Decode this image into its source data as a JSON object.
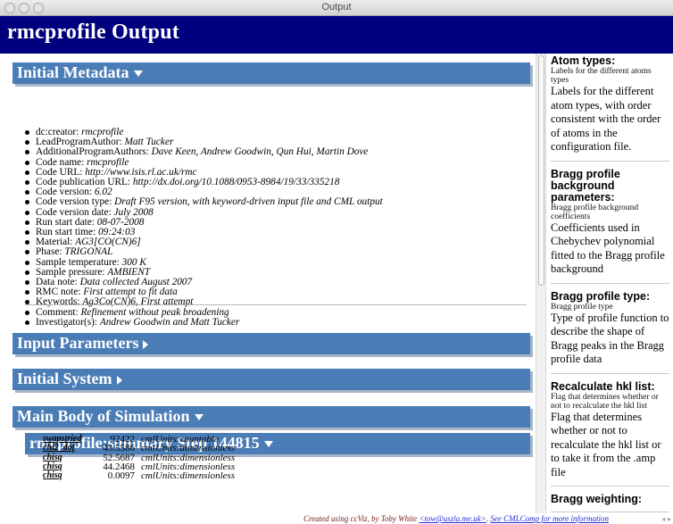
{
  "window": {
    "title": "Output"
  },
  "app": {
    "title": "rmcprofile Output"
  },
  "sections": {
    "initial_metadata": "Initial Metadata",
    "input_parameters": "Input Parameters",
    "initial_system": "Initial System",
    "main_body": "Main Body of Simulation",
    "summary_step": "rmcprofile:summary Step 144815"
  },
  "metadata": [
    {
      "key": "dc:creator: ",
      "value": "rmcprofile"
    },
    {
      "key": "LeadProgramAuthor: ",
      "value": "Matt Tucker"
    },
    {
      "key": "AdditionalProgramAuthors: ",
      "value": "Dave Keen, Andrew Goodwin, Qun Hui, Martin Dove"
    },
    {
      "key": "Code name: ",
      "value": "rmcprofile"
    },
    {
      "key": "Code URL: ",
      "value": "http://www.isis.rl.ac.uk/rmc"
    },
    {
      "key": "Code publication URL: ",
      "value": "http://dx.doi.org/10.1088/0953-8984/19/33/335218"
    },
    {
      "key": "Code version: ",
      "value": "6.02"
    },
    {
      "key": "Code version type: ",
      "value": "Draft F95 version, with keyword-driven input file and CML output"
    },
    {
      "key": "Code version date: ",
      "value": "July 2008"
    },
    {
      "key": "Run start date: ",
      "value": "08-07-2008"
    },
    {
      "key": "Run start time: ",
      "value": "09:24:03"
    },
    {
      "key": "Material: ",
      "value": "AG3[CO(CN)6]"
    },
    {
      "key": "Phase: ",
      "value": "TRIGONAL"
    },
    {
      "key": "Sample temperature: ",
      "value": "300 K"
    },
    {
      "key": "Sample pressure: ",
      "value": "AMBIENT"
    },
    {
      "key": "Data note: ",
      "value": "Data collected August 2007"
    },
    {
      "key": "RMC note: ",
      "value": "First attempt to fit data"
    },
    {
      "key": "Keywords: ",
      "value": "Ag3Co(CN)6, First attempt"
    },
    {
      "key": "Comment: ",
      "value": "Refinement without peak broadening"
    },
    {
      "key": "Investigator(s): ",
      "value": "Andrew Goodwin and Matt Tucker"
    }
  ],
  "summary_rows": [
    {
      "key": "swapstried",
      "value": "92422",
      "unit": "cmlUnits:countable"
    },
    {
      "key": "chi2_dof",
      "value": "43.5586",
      "unit": "cmlUnits:dimensionless"
    },
    {
      "key": "chisq",
      "value": "52.5687",
      "unit": "cmlUnits:dimensionless"
    },
    {
      "key": "chisq",
      "value": "44.2468",
      "unit": "cmlUnits:dimensionless"
    },
    {
      "key": "chisq",
      "value": "0.0097",
      "unit": "cmlUnits:dimensionless"
    }
  ],
  "sidebar": [
    {
      "heading": "Atom types:",
      "sub": "Labels for the different atoms types",
      "desc": "Labels for the different atom types, with order consistent with the order of atoms in the configuration file."
    },
    {
      "heading": "Bragg profile background parameters:",
      "sub": "Bragg profile background coefficients",
      "desc": "Coefficients used in Chebychev polynomial fitted to the Bragg profile background"
    },
    {
      "heading": "Bragg profile type:",
      "sub": "Bragg profile type",
      "desc": "Type of profile function to describe the shape of Bragg peaks in the Bragg profile data"
    },
    {
      "heading": "Recalculate hkl list:",
      "sub": "Flag that determines whether or not to recalculate the hkl list",
      "desc": "Flag that determines whether or not to recalculate the hkl list or to take it from the .amp file"
    },
    {
      "heading": "Bragg weighting:",
      "sub": "",
      "desc": ""
    }
  ],
  "footer": {
    "prefix": "Created using ccViz, by Toby White ",
    "email": "<tow@uszla.me.uk>",
    "sep": ". ",
    "link": "See CMLComp for more information"
  },
  "colors": {
    "header_band": "#00007f",
    "section_bar": "#4a7cb6",
    "section_shadow": "#a9b6c7"
  }
}
